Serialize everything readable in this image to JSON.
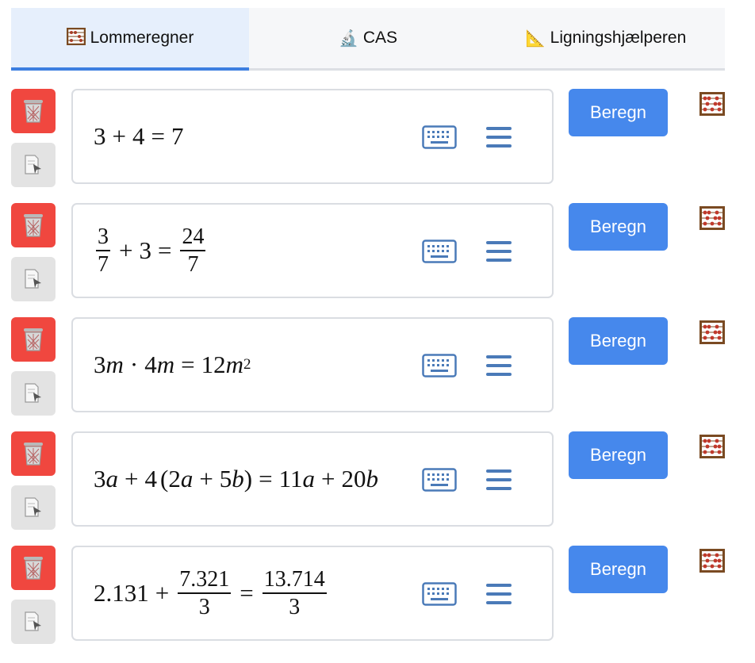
{
  "tabs": [
    {
      "label": "Lommeregner",
      "icon": "abacus-icon",
      "active": true
    },
    {
      "label": "CAS",
      "icon": "microscope-icon",
      "active": false
    },
    {
      "label": "Ligningshjælperen",
      "icon": "triangle-ruler-icon",
      "active": false
    }
  ],
  "calc_button_label": "Beregn",
  "colors": {
    "delete_button": "#f0473f",
    "copy_button": "#e3e3e3",
    "calc_button": "#4688ec",
    "active_tab_bg": "#e6effc",
    "active_tab_underline": "#3d7fe0",
    "icon_blue": "#4a7ab8"
  },
  "rows": [
    {
      "expr": "3 + 4 = 7",
      "tokens": [
        "3",
        "+",
        "4",
        "=",
        "7"
      ]
    },
    {
      "expr": "3/7 + 3 = 24/7",
      "tokens": [
        "3",
        "7",
        "+",
        "3",
        "=",
        "24",
        "7"
      ]
    },
    {
      "expr": "3m · 4m = 12m^2",
      "tokens": [
        "3",
        "m",
        "·",
        "4",
        "m",
        "=",
        "12",
        "m",
        "2"
      ]
    },
    {
      "expr": "3a + 4(2a + 5b) = 11a + 20b",
      "tokens": [
        "3",
        "a",
        "+",
        "4",
        "(",
        "2",
        "a",
        "+",
        "5",
        "b",
        ")",
        "=",
        "11",
        "a",
        "+",
        "20",
        "b"
      ]
    },
    {
      "expr": "2.131 + 7.321/3 = 13.714/3",
      "tokens": [
        "2.131",
        "+",
        "7.321",
        "3",
        "=",
        "13.714",
        "3"
      ]
    }
  ]
}
